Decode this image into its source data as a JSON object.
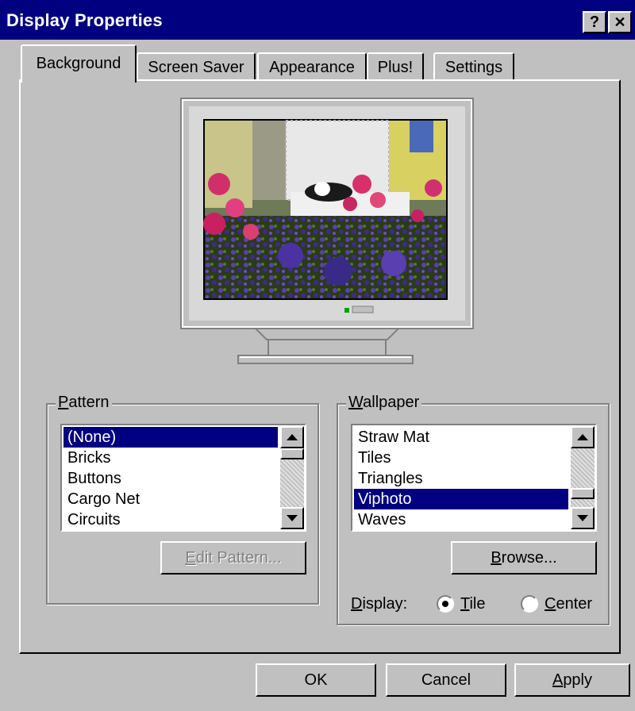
{
  "window": {
    "title": "Display Properties",
    "help_glyph": "?",
    "close_glyph": "✕"
  },
  "tabs": [
    {
      "label": "Background",
      "active": true
    },
    {
      "label": "Screen Saver"
    },
    {
      "label": "Appearance"
    },
    {
      "label": "Plus!"
    },
    {
      "label": "Settings"
    }
  ],
  "pattern": {
    "group_label_mn": "P",
    "group_label_rest": "attern",
    "items": [
      "(None)",
      "Bricks",
      "Buttons",
      "Cargo Net",
      "Circuits"
    ],
    "selected_index": 0,
    "edit_mn": "E",
    "edit_rest": "dit Pattern..."
  },
  "wallpaper": {
    "group_label_mn": "W",
    "group_label_rest": "allpaper",
    "items": [
      "Straw Mat",
      "Tiles",
      "Triangles",
      "Viphoto",
      "Waves"
    ],
    "selected_index": 3,
    "browse_mn": "B",
    "browse_rest": "rowse...",
    "display_mn": "D",
    "display_rest": "isplay:",
    "tile_mn": "T",
    "tile_rest": "ile",
    "center_mn": "C",
    "center_rest": "enter",
    "display_mode": "tile"
  },
  "buttons": {
    "ok": "OK",
    "cancel": "Cancel",
    "apply_mn": "A",
    "apply_rest": "pply"
  },
  "colors": {
    "titlebar": "#000080",
    "selection": "#000080",
    "face": "#c0c0c0"
  }
}
